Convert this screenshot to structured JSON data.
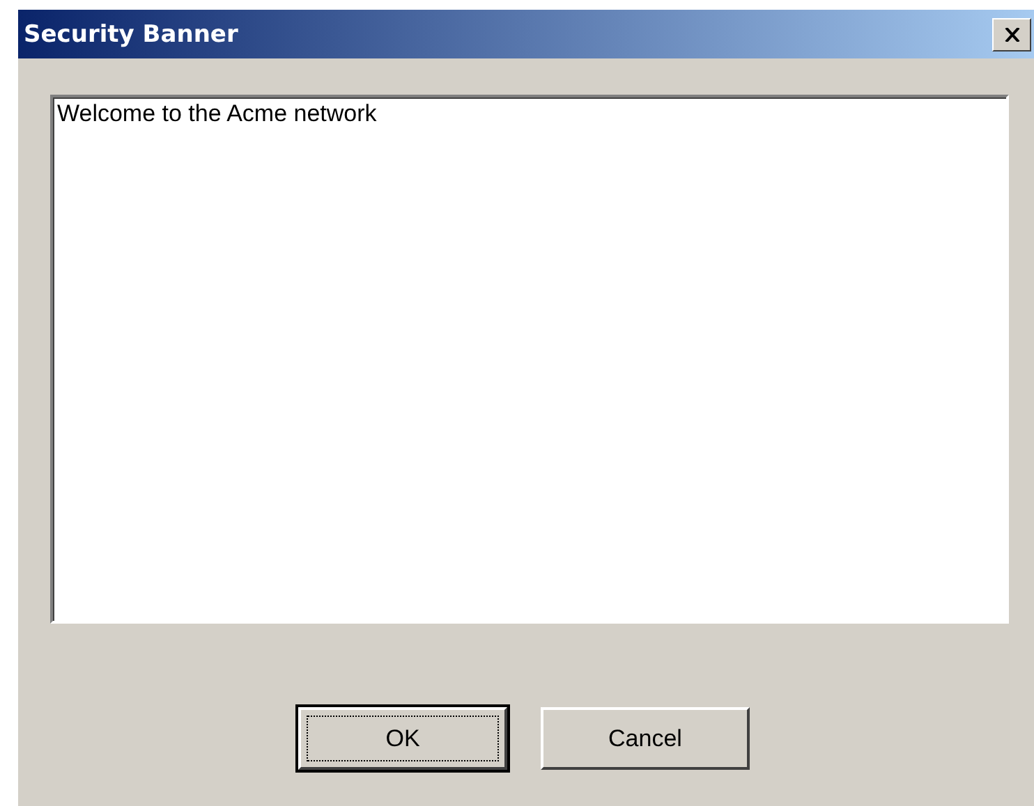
{
  "window": {
    "title": "Security Banner"
  },
  "message": {
    "value": "Welcome to the Acme network"
  },
  "buttons": [
    {
      "label": "OK",
      "focused": true
    },
    {
      "label": "Cancel",
      "focused": false
    }
  ]
}
